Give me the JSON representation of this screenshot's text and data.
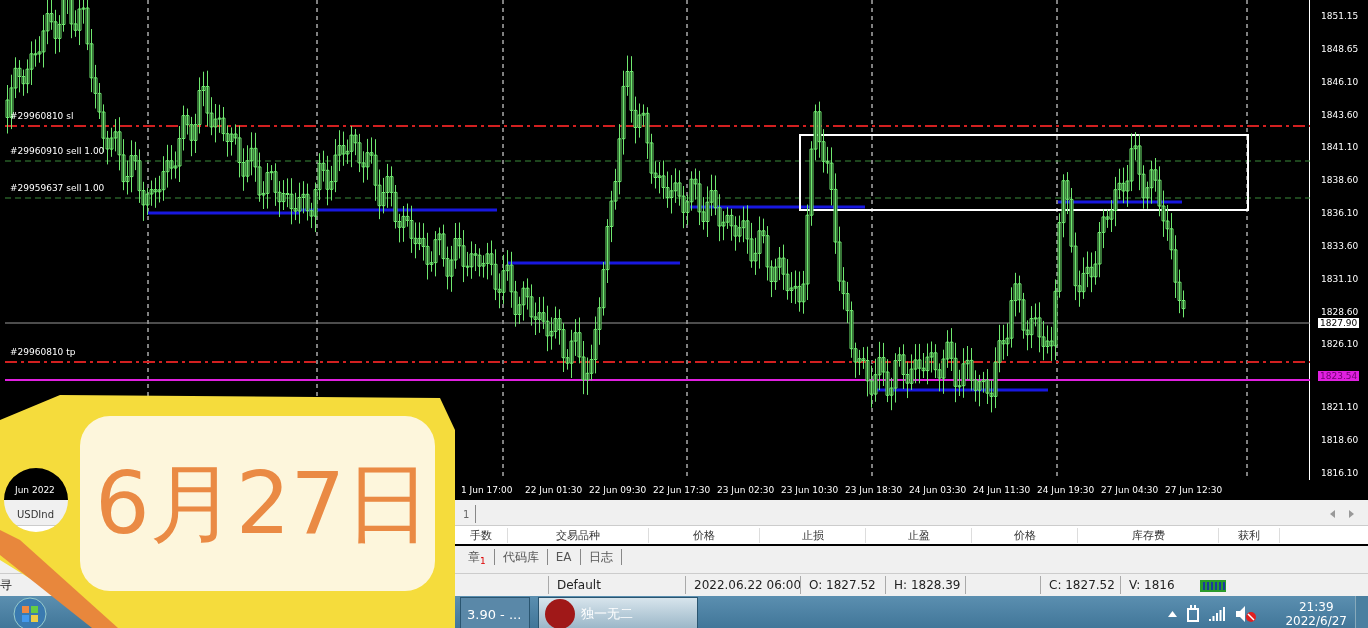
{
  "chart": {
    "order_lines": [
      {
        "label": "#29960810 sl",
        "kind": "sl"
      },
      {
        "label": "#29960910 sell 1.00",
        "kind": "sell"
      },
      {
        "label": "#29959637 sell 1.00",
        "kind": "sell"
      },
      {
        "label": "#29960810 tp",
        "kind": "tp"
      }
    ],
    "price_axis": [
      "1851.15",
      "1848.65",
      "1846.10",
      "1843.60",
      "1841.10",
      "1838.60",
      "1836.10",
      "1833.60",
      "1831.10",
      "1828.60",
      "1826.10",
      "1821.10",
      "1818.60",
      "1816.10"
    ],
    "current_price": "1827.90",
    "line_price": "1823.54",
    "time_axis": [
      "Jun 2022",
      "1 Jun 17:00",
      "22 Jun 01:30",
      "22 Jun 09:30",
      "22 Jun 17:30",
      "23 Jun 02:30",
      "23 Jun 10:30",
      "23 Jun 18:30",
      "24 Jun 03:30",
      "24 Jun 11:30",
      "24 Jun 19:30",
      "27 Jun 04:30",
      "27 Jun 12:30"
    ]
  },
  "chart_tabs": [
    {
      "label": "USDInd",
      "selected": true
    },
    {
      "label": "1",
      "selected": false
    }
  ],
  "columns": [
    "手数",
    "交易品种",
    "价格",
    "止损",
    "止盈",
    "价格",
    "库存费",
    "获利"
  ],
  "terminal_tabs": [
    {
      "label": "章$_{1}$",
      "selected": false
    },
    {
      "label": "代码库",
      "selected": false
    },
    {
      "label": "EA",
      "selected": false
    },
    {
      "label": "日志",
      "selected": false
    }
  ],
  "status_bar": {
    "help": "寻",
    "profile": "Default",
    "time": "2022.06.22 06:00",
    "open": "O: 1827.52",
    "high": "H: 1828.39",
    "close": "C: 1827.52",
    "volume": "V: 1816"
  },
  "taskbar": {
    "windows": [
      {
        "title": "3.90 - ...",
        "selected": false
      },
      {
        "title": "独一无二",
        "selected": true
      }
    ],
    "clock_time": "21:39",
    "clock_date": "2022/6/27"
  },
  "sticker": {
    "text": "6月27日"
  }
}
